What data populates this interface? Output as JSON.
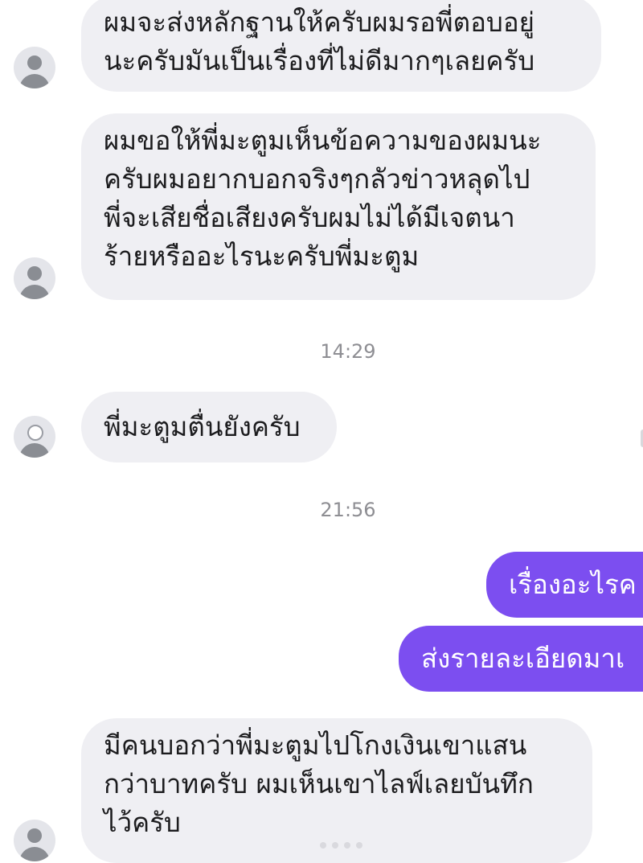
{
  "messages": [
    {
      "sender": "other",
      "lines": [
        "ผมจะส่งหลักฐานให้ครับผมรอพี่ตอบอยู่",
        "นะครับมันเป็นเรื่องที่ไม่ดีมากๆเลยครับ"
      ]
    },
    {
      "sender": "other",
      "lines": [
        "ผมขอให้พี่มะตูมเห็นข้อความของผมนะ",
        "ครับผมอยากบอกจริงๆกลัวข่าวหลุดไป",
        "พี่จะเสียชื่อเสียงครับผมไม่ได้มีเจตนา",
        "ร้ายหรืออะไรนะครับพี่มะตูม"
      ]
    },
    {
      "sender": "other",
      "lines": [
        "พี่มะตูมตื่นยังครับ"
      ]
    },
    {
      "sender": "me",
      "lines": [
        "เรื่องอะไรค"
      ]
    },
    {
      "sender": "me",
      "lines": [
        "ส่งรายละเอียดมาเ"
      ]
    },
    {
      "sender": "other",
      "lines": [
        "มีคนบอกว่าพี่มะตูมไปโกงเงินเขาแสน",
        "กว่าบาทครับ ผมเห็นเขาไลฟ์เลยบันทึก",
        "ไว้ครับ"
      ]
    }
  ],
  "timestamps": [
    "14:29",
    "21:56"
  ],
  "colors": {
    "incoming_bubble": "#efeff3",
    "outgoing_bubble": "#7c4ef0",
    "timestamp_text": "#8e8e93",
    "avatar_placeholder": "#8a8d93"
  },
  "icons": {
    "avatar": "default-person-avatar-icon"
  }
}
